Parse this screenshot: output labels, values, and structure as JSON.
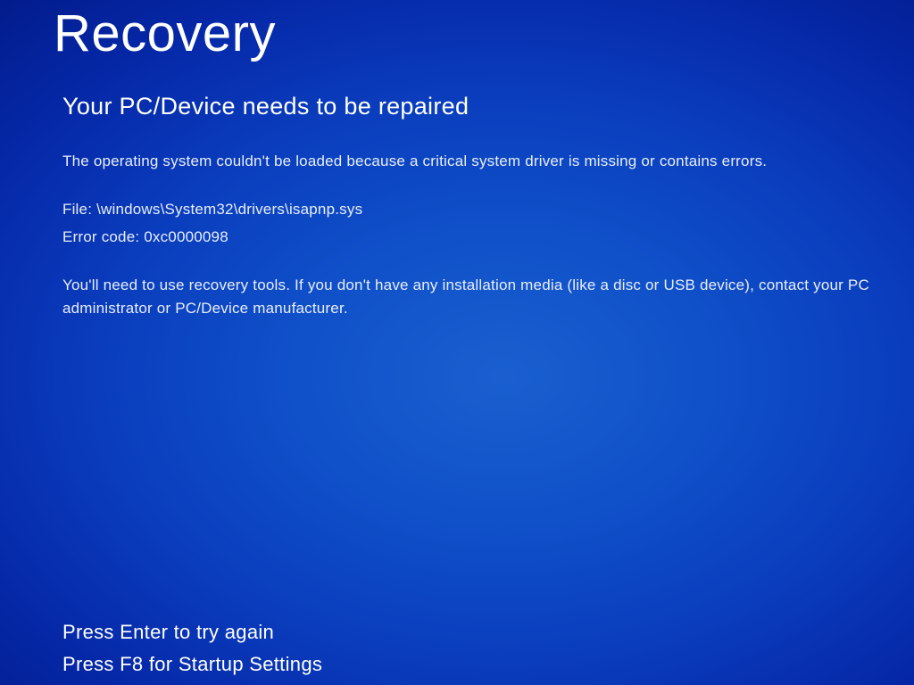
{
  "screen": {
    "title": "Recovery",
    "subtitle": "Your PC/Device needs to be repaired",
    "cause": "The operating system couldn't be loaded because a critical system driver is missing or contains errors.",
    "file_label": "File:",
    "file_path": "\\windows\\System32\\drivers\\isapnp.sys",
    "error_label": "Error code:",
    "error_code": "0xc0000098",
    "recovery_message": "You'll need to use recovery tools. If you don't have any installation media (like a disc or USB device), contact your PC administrator or PC/Device manufacturer.",
    "instructions": {
      "enter": "Press Enter to try again",
      "f8": "Press F8 for Startup Settings"
    }
  }
}
